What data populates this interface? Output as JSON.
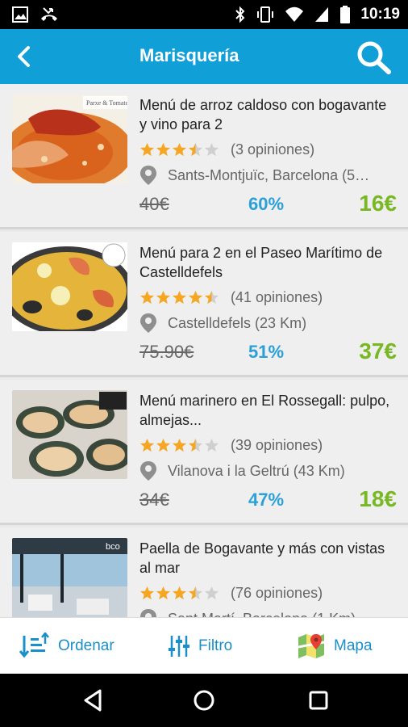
{
  "status": {
    "time": "10:19"
  },
  "header": {
    "title": "Marisquería"
  },
  "colors": {
    "primary": "#119fd8",
    "discount": "#2ba0d8",
    "price": "#78b822",
    "star": "#f5a623"
  },
  "deals": [
    {
      "title": "Menú de arroz caldoso con bogavante y vino para 2",
      "rating": 3.5,
      "reviews": "(3 opiniones)",
      "location": "Sants-Montjuïc, Barcelona (5…",
      "old_price": "40€",
      "discount": "60%",
      "price": "16€",
      "thumb_text": "Parxe & Tomatoe"
    },
    {
      "title": "Menú para 2 en el Paseo Marítimo de Castelldefels",
      "rating": 4.5,
      "reviews": "(41 opiniones)",
      "location": "Castelldefels (23 Km)",
      "old_price": "75.90€",
      "discount": "51%",
      "price": "37€",
      "thumb_text": ""
    },
    {
      "title": "Menú marinero en El Rossegall: pulpo, almejas...",
      "rating": 3.5,
      "reviews": "(39 opiniones)",
      "location": "Vilanova i la Geltrú (43 Km)",
      "old_price": "34€",
      "discount": "47%",
      "price": "18€",
      "thumb_text": ""
    },
    {
      "title": "Paella de Bogavante y más con vistas al mar",
      "rating": 3.5,
      "reviews": "(76 opiniones)",
      "location": "Sant Martí, Barcelona (1 Km)",
      "old_price": "",
      "discount": "",
      "price": "",
      "thumb_text": "bco"
    }
  ],
  "bottom_bar": {
    "sort_label": "Ordenar",
    "filter_label": "Filtro",
    "map_label": "Mapa"
  },
  "icons": [
    "image-icon",
    "missed-call-icon",
    "bluetooth-icon",
    "vibrate-icon",
    "wifi-icon",
    "signal-icon",
    "battery-icon",
    "back-arrow-icon",
    "search-icon",
    "star-icon",
    "location-pin-icon",
    "sort-icon",
    "filter-icon",
    "map-icon",
    "nav-back-icon",
    "nav-home-icon",
    "nav-recents-icon"
  ]
}
